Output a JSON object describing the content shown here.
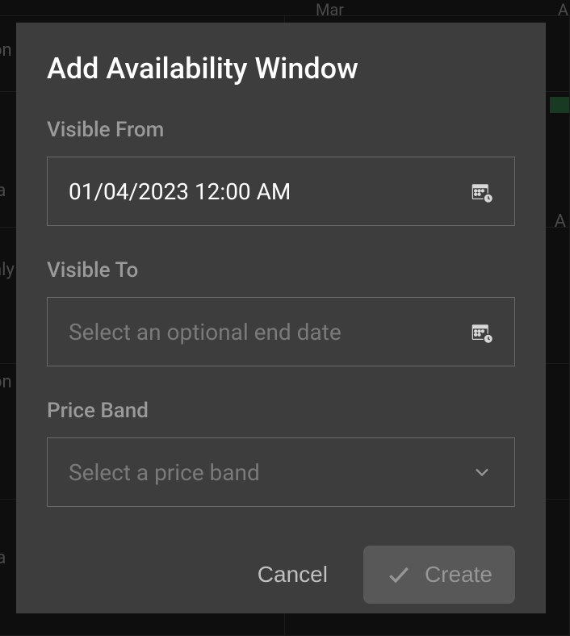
{
  "background": {
    "header": {
      "month1": "Mar",
      "month2": "A"
    },
    "rowLabels": [
      "on",
      "la",
      "nly",
      "on",
      "la"
    ],
    "letterA": "A"
  },
  "modal": {
    "title": "Add Availability Window",
    "visibleFrom": {
      "label": "Visible From",
      "value": "01/04/2023 12:00 AM"
    },
    "visibleTo": {
      "label": "Visible To",
      "placeholder": "Select an optional end date"
    },
    "priceBand": {
      "label": "Price Band",
      "placeholder": "Select a price band"
    },
    "buttons": {
      "cancel": "Cancel",
      "create": "Create"
    }
  }
}
